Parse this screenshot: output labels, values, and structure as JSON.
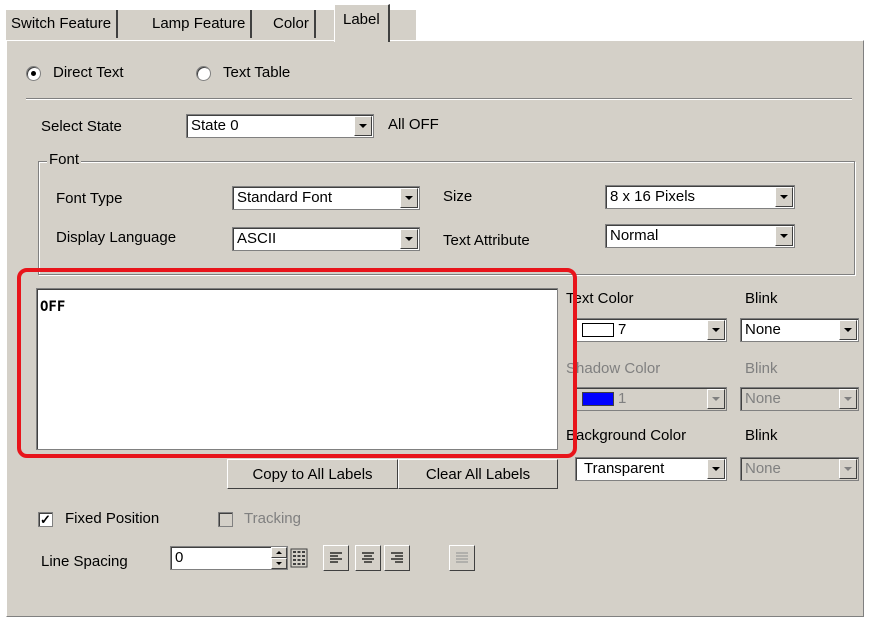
{
  "tabs": [
    {
      "label": "Switch Feature",
      "active": false
    },
    {
      "label": "Lamp Feature",
      "active": false
    },
    {
      "label": "Color",
      "active": false
    },
    {
      "label": "Label",
      "active": true
    }
  ],
  "text_source": {
    "options": [
      {
        "label": "Direct Text",
        "checked": true
      },
      {
        "label": "Text Table",
        "checked": false
      }
    ]
  },
  "select_state": {
    "label": "Select State",
    "value": "State 0",
    "note": "All OFF"
  },
  "font": {
    "group_title": "Font",
    "font_type_label": "Font Type",
    "font_type_value": "Standard Font",
    "size_label": "Size",
    "size_value": "8 x 16 Pixels",
    "display_language_label": "Display Language",
    "display_language_value": "ASCII",
    "text_attribute_label": "Text Attribute",
    "text_attribute_value": "Normal"
  },
  "label_text": "OFF",
  "colors": {
    "text_color_label": "Text Color",
    "text_color_value": "7",
    "text_color_swatch": "#ffffff",
    "text_blink_label": "Blink",
    "text_blink_value": "None",
    "shadow_color_label": "Shadow Color",
    "shadow_color_value": "1",
    "shadow_color_swatch": "#0000ff",
    "shadow_blink_label": "Blink",
    "shadow_blink_value": "None",
    "background_color_label": "Background Color",
    "background_color_value": "Transparent",
    "background_blink_label": "Blink",
    "background_blink_value": "None"
  },
  "buttons": {
    "copy_label": "Copy to All Labels",
    "clear_label": "Clear All Labels"
  },
  "options": {
    "fixed_position_label": "Fixed Position",
    "fixed_position_checked": true,
    "tracking_label": "Tracking",
    "tracking_checked": false
  },
  "line_spacing": {
    "label": "Line Spacing",
    "value": "0"
  },
  "alignment_buttons": [
    "align-left",
    "align-center",
    "align-right",
    "justify"
  ],
  "highlight_color": "#e8141b"
}
